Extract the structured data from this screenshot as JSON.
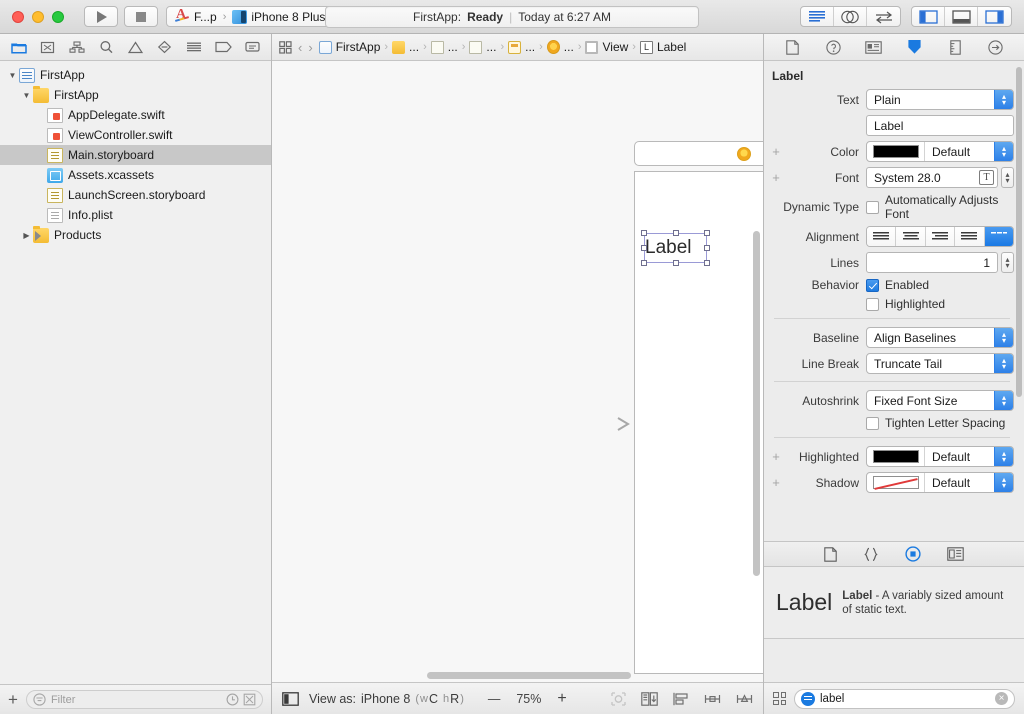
{
  "titlebar": {
    "run_label": "run-button",
    "stop_label": "stop-button",
    "scheme": "F...p",
    "scheme_sep": "›",
    "destination": "iPhone 8 Plus",
    "status_project": "FirstApp:",
    "status_state": "Ready",
    "status_divider": "|",
    "status_time": "Today at 6:27 AM",
    "editor_modes": [
      "standard-editor",
      "assistant-editor",
      "version-editor"
    ],
    "view_toggles": [
      "toggle-navigator",
      "toggle-debug-area",
      "toggle-utilities"
    ]
  },
  "navigator": {
    "tabs": [
      "project-navigator",
      "source-control-navigator",
      "symbol-navigator",
      "find-navigator",
      "issue-navigator",
      "test-navigator",
      "debug-navigator",
      "breakpoint-navigator",
      "report-navigator"
    ],
    "tree": [
      {
        "label": "FirstApp",
        "indent": 0,
        "icon": "project",
        "disclosure": "▼",
        "selected": false
      },
      {
        "label": "FirstApp",
        "indent": 1,
        "icon": "folder",
        "disclosure": "▼",
        "selected": false
      },
      {
        "label": "AppDelegate.swift",
        "indent": 2,
        "icon": "swift",
        "disclosure": "",
        "selected": false
      },
      {
        "label": "ViewController.swift",
        "indent": 2,
        "icon": "swift",
        "disclosure": "",
        "selected": false
      },
      {
        "label": "Main.storyboard",
        "indent": 2,
        "icon": "storyboard",
        "disclosure": "",
        "selected": true
      },
      {
        "label": "Assets.xcassets",
        "indent": 2,
        "icon": "assets",
        "disclosure": "",
        "selected": false
      },
      {
        "label": "LaunchScreen.storyboard",
        "indent": 2,
        "icon": "storyboard",
        "disclosure": "",
        "selected": false
      },
      {
        "label": "Info.plist",
        "indent": 2,
        "icon": "plist",
        "disclosure": "",
        "selected": false
      },
      {
        "label": "Products",
        "indent": 1,
        "icon": "products",
        "disclosure": "▶",
        "selected": false
      }
    ],
    "add_label": "+",
    "filter_placeholder": "Filter"
  },
  "jumpbar": {
    "back": "‹",
    "forward": "›",
    "crumbs": [
      {
        "label": "FirstApp",
        "icon": "project"
      },
      {
        "label": "...",
        "icon": "folder"
      },
      {
        "label": "...",
        "icon": "file"
      },
      {
        "label": "...",
        "icon": "file"
      },
      {
        "label": "...",
        "icon": "viewcontroller"
      },
      {
        "label": "...",
        "icon": "circle"
      },
      {
        "label": "View",
        "icon": "view"
      },
      {
        "label": "Label",
        "icon": "label",
        "icon_text": "L"
      }
    ]
  },
  "canvas": {
    "label_text": "Label",
    "dock_items": [
      "view-controller",
      "first-responder",
      "exit"
    ]
  },
  "canvas_bottom": {
    "view_as_prefix": "View as:",
    "view_as_device": "iPhone 8",
    "view_as_traits_open": "(",
    "view_as_w": "w",
    "view_as_wc": "C",
    "view_as_h": "h",
    "view_as_hr": "R",
    "view_as_traits_close": ")",
    "zoom_out": "—",
    "zoom_level": "75%",
    "zoom_in": "+",
    "tools": [
      "update-frames",
      "embed-in",
      "align",
      "add-new-constraints",
      "resolve-auto-layout-issues"
    ]
  },
  "inspector": {
    "tabs": [
      "file-inspector",
      "quick-help-inspector",
      "identity-inspector",
      "attributes-inspector",
      "size-inspector",
      "connections-inspector"
    ],
    "title": "Label",
    "fields": {
      "text_label": "Text",
      "text_value": "Plain",
      "text_content": "Label",
      "color_label": "Color",
      "color_value": "Default",
      "color_swatch": "#000000",
      "font_label": "Font",
      "font_value": "System 28.0",
      "dynamic_type_label": "Dynamic Type",
      "dynamic_type_checkbox": "Automatically Adjusts Font",
      "dynamic_type_checked": false,
      "alignment_label": "Alignment",
      "alignment_options": [
        "left",
        "center",
        "right",
        "justified",
        "natural"
      ],
      "alignment_selected_index": 4,
      "lines_label": "Lines",
      "lines_value": "1",
      "behavior_label": "Behavior",
      "behavior_enabled": "Enabled",
      "behavior_enabled_checked": true,
      "behavior_highlighted": "Highlighted",
      "behavior_highlighted_checked": false,
      "baseline_label": "Baseline",
      "baseline_value": "Align Baselines",
      "line_break_label": "Line Break",
      "line_break_value": "Truncate Tail",
      "autoshrink_label": "Autoshrink",
      "autoshrink_value": "Fixed Font Size",
      "tighten_label": "Tighten Letter Spacing",
      "tighten_checked": false,
      "highlighted_label": "Highlighted",
      "highlighted_value": "Default",
      "shadow_label": "Shadow",
      "shadow_value": "Default",
      "plus": "+"
    }
  },
  "library": {
    "subtabs": [
      "file-template-library",
      "code-snippet-library",
      "object-library",
      "media-library"
    ],
    "active_subtab_index": 2,
    "quick_help_preview": "Label",
    "quick_help_title": "Label",
    "quick_help_desc": " - A variably sized amount of static text.",
    "search_value": "label",
    "search_clear": "×"
  }
}
